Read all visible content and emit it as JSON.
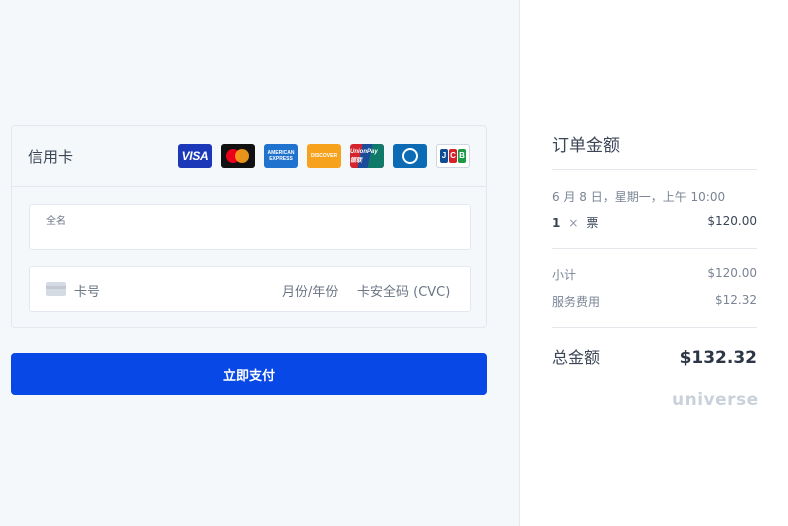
{
  "payment": {
    "method_label": "信用卡",
    "brands": {
      "visa": "VISA",
      "amex": "AMERICAN EXPRESS",
      "discover": "DISCOVER",
      "unionpay": "UnionPay 银联",
      "jcb": [
        "J",
        "C",
        "B"
      ]
    },
    "name_field_label": "全名",
    "card_number_placeholder": "卡号",
    "expiry_placeholder": "月份/年份",
    "cvc_placeholder": "卡安全码 (CVC)",
    "pay_button": "立即支付"
  },
  "summary": {
    "title": "订单金额",
    "date": "6 月 8 日，星期一，上午 10:00",
    "item": {
      "qty": "1",
      "times": "×",
      "name": "票",
      "price": "$120.00"
    },
    "subtotal_label": "小计",
    "subtotal_value": "$120.00",
    "fee_label": "服务费用",
    "fee_value": "$12.32",
    "total_label": "总金额",
    "total_value": "$132.32",
    "logo": "universe"
  },
  "colors": {
    "primary": "#0748e6",
    "background": "#f5f8fb",
    "text": "#3b4556",
    "muted": "#7a8495"
  }
}
